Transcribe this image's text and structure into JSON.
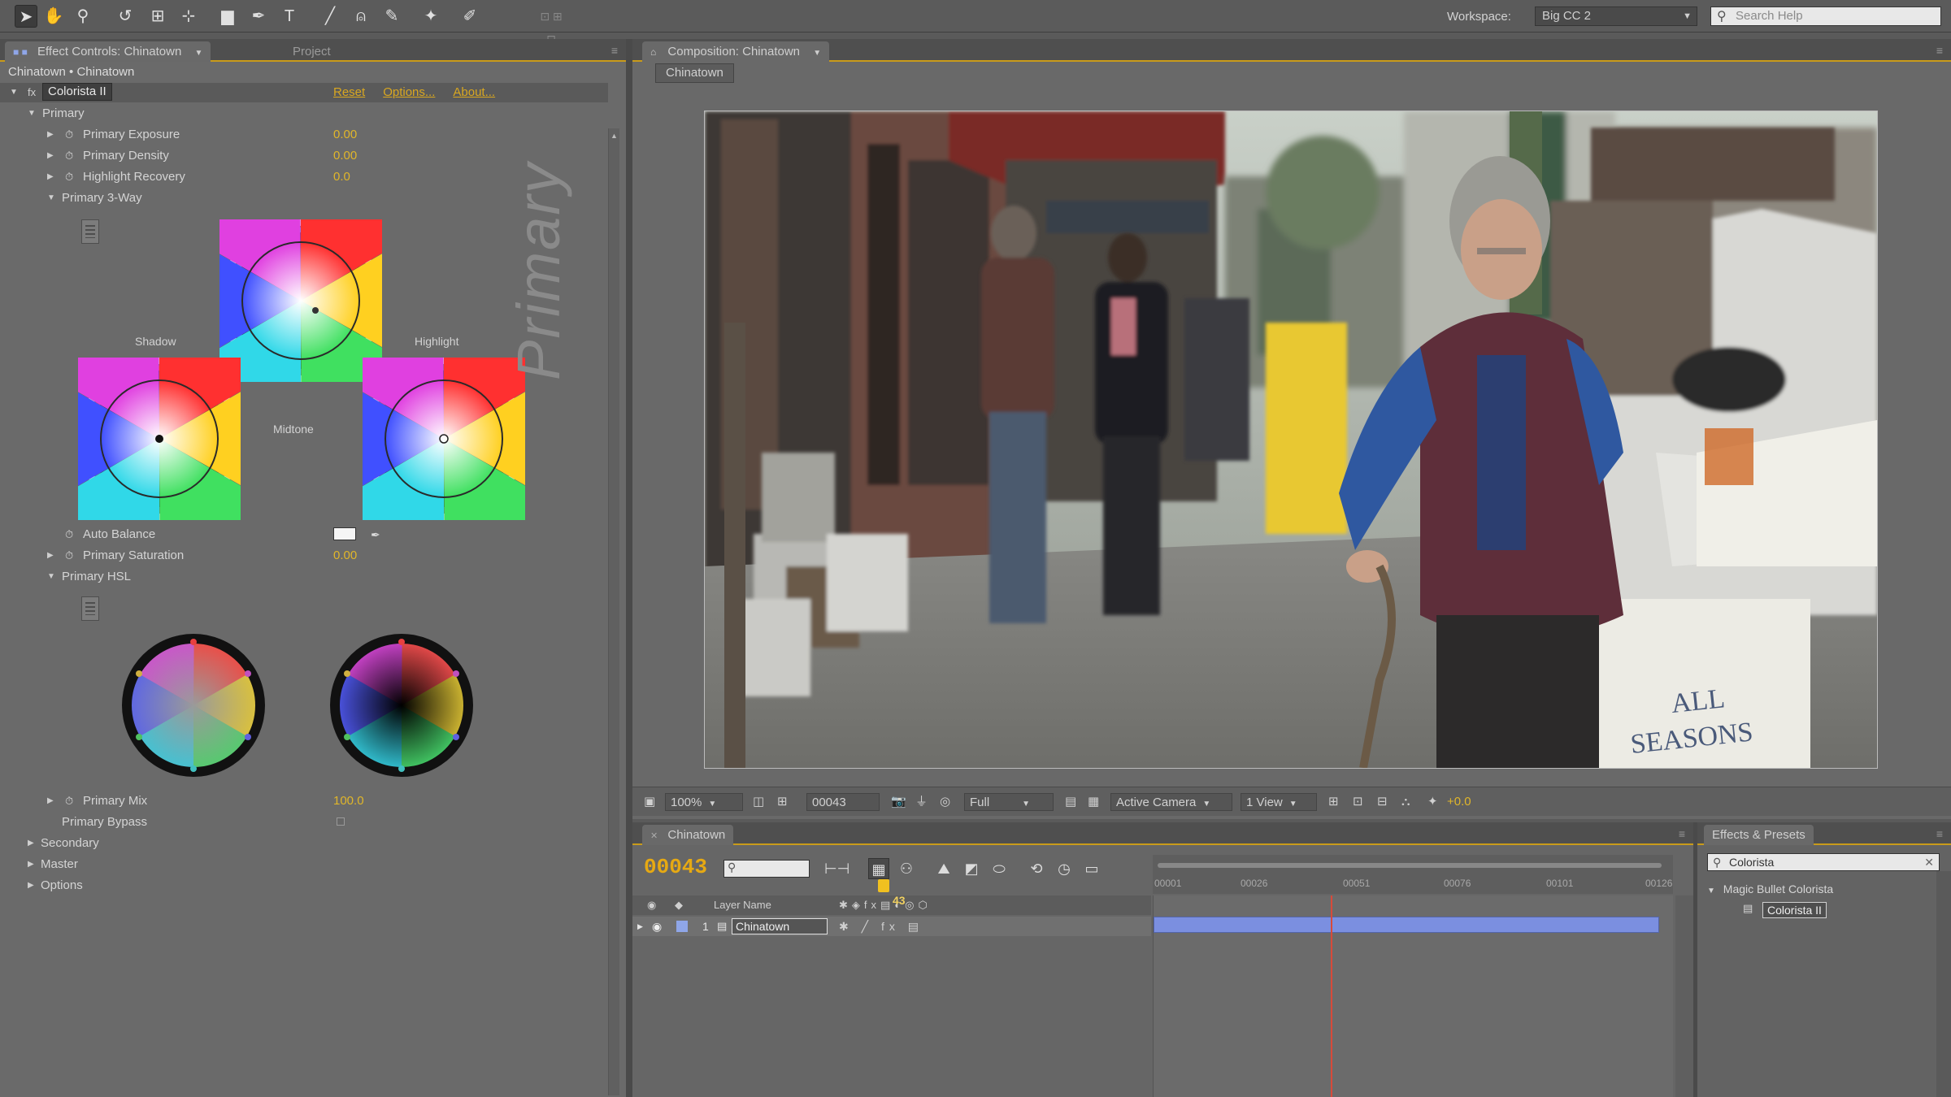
{
  "toolbar": {
    "tools": [
      "selection-tool",
      "hand-tool",
      "zoom-tool",
      "rotate-tool",
      "camera-tool",
      "pan-tool",
      "mask-tool",
      "pen-tool",
      "type-tool",
      "brush-tool",
      "clone-tool",
      "eraser-tool",
      "roto-tool",
      "puppet-tool"
    ],
    "workspace_label": "Workspace:",
    "workspace_value": "Big CC 2",
    "search_placeholder": "Search Help"
  },
  "effect_controls": {
    "tab_label": "Effect Controls: Chinatown",
    "project_tab": "Project",
    "title": "Chinatown • Chinatown",
    "effect_name": "Colorista II",
    "links": [
      "Reset",
      "Options...",
      "About..."
    ],
    "group_primary": "Primary",
    "primary_exposure": {
      "label": "Primary Exposure",
      "value": "0.00"
    },
    "primary_density": {
      "label": "Primary Density",
      "value": "0.00"
    },
    "highlight_recovery": {
      "label": "Highlight Recovery",
      "value": "0.0"
    },
    "primary_3way": "Primary 3-Way",
    "wheel_shadow": "Shadow",
    "wheel_midtone": "Midtone",
    "wheel_highlight": "Highlight",
    "vertical_label": "Primary",
    "auto_balance": "Auto Balance",
    "primary_saturation": {
      "label": "Primary Saturation",
      "value": "0.00"
    },
    "primary_hsl": "Primary HSL",
    "primary_mix": {
      "label": "Primary Mix",
      "value": "100.0"
    },
    "primary_bypass": "Primary Bypass",
    "secondary": "Secondary",
    "master": "Master",
    "options": "Options"
  },
  "composition": {
    "tab_label": "Composition: Chinatown",
    "sub_tab": "Chinatown",
    "zoom": "100%",
    "timecode": "00043",
    "resolution": "Full",
    "camera": "Active Camera",
    "views": "1 View",
    "exposure": "+0.0"
  },
  "timeline": {
    "tab_label": "Chinatown",
    "current_time": "00043",
    "ticks": [
      "00001",
      "00026",
      "00051",
      "00076",
      "00101",
      "00126"
    ],
    "playhead_label": "43",
    "header_layer_name": "Layer Name",
    "layer": {
      "index": "1",
      "name": "Chinatown"
    }
  },
  "effects_presets": {
    "tab_label": "Effects & Presets",
    "search_value": "Colorista",
    "category": "Magic Bullet Colorista",
    "item": "Colorista II"
  },
  "colors": {
    "accent": "#e0b62a",
    "timecode": "#e6a913",
    "layer_bar": "#7b8fe0",
    "playhead": "#d84a3a"
  }
}
